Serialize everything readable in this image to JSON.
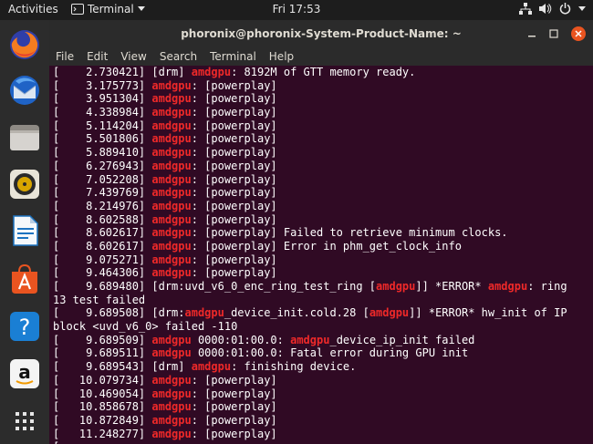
{
  "topbar": {
    "activities": "Activities",
    "app_menu": "Terminal",
    "clock": "Fri 17:53"
  },
  "dock": {
    "items": [
      {
        "name": "firefox-icon"
      },
      {
        "name": "thunderbird-icon"
      },
      {
        "name": "files-icon"
      },
      {
        "name": "rhythmbox-icon"
      },
      {
        "name": "libreoffice-writer-icon"
      },
      {
        "name": "ubuntu-software-icon"
      },
      {
        "name": "help-icon"
      },
      {
        "name": "amazon-icon"
      },
      {
        "name": "show-applications-icon"
      }
    ]
  },
  "window": {
    "title": "phoronix@phoronix-System-Product-Name: ~",
    "menu": [
      "File",
      "Edit",
      "View",
      "Search",
      "Terminal",
      "Help"
    ]
  },
  "colors": {
    "terminal_bg": "#300a24",
    "highlight": "#ef2929",
    "text": "#ffffff"
  },
  "terminal": {
    "lines": [
      [
        {
          "t": "[    2.730421] [drm] "
        },
        {
          "t": "amdgpu",
          "h": true
        },
        {
          "t": ": 8192M of GTT memory ready."
        }
      ],
      [
        {
          "t": "[    3.175773] "
        },
        {
          "t": "amdgpu",
          "h": true
        },
        {
          "t": ": [powerplay]"
        }
      ],
      [
        {
          "t": "[    3.951304] "
        },
        {
          "t": "amdgpu",
          "h": true
        },
        {
          "t": ": [powerplay]"
        }
      ],
      [
        {
          "t": "[    4.338984] "
        },
        {
          "t": "amdgpu",
          "h": true
        },
        {
          "t": ": [powerplay]"
        }
      ],
      [
        {
          "t": "[    5.114204] "
        },
        {
          "t": "amdgpu",
          "h": true
        },
        {
          "t": ": [powerplay]"
        }
      ],
      [
        {
          "t": "[    5.501806] "
        },
        {
          "t": "amdgpu",
          "h": true
        },
        {
          "t": ": [powerplay]"
        }
      ],
      [
        {
          "t": "[    5.889410] "
        },
        {
          "t": "amdgpu",
          "h": true
        },
        {
          "t": ": [powerplay]"
        }
      ],
      [
        {
          "t": "[    6.276943] "
        },
        {
          "t": "amdgpu",
          "h": true
        },
        {
          "t": ": [powerplay]"
        }
      ],
      [
        {
          "t": "[    7.052208] "
        },
        {
          "t": "amdgpu",
          "h": true
        },
        {
          "t": ": [powerplay]"
        }
      ],
      [
        {
          "t": "[    7.439769] "
        },
        {
          "t": "amdgpu",
          "h": true
        },
        {
          "t": ": [powerplay]"
        }
      ],
      [
        {
          "t": "[    8.214976] "
        },
        {
          "t": "amdgpu",
          "h": true
        },
        {
          "t": ": [powerplay]"
        }
      ],
      [
        {
          "t": "[    8.602588] "
        },
        {
          "t": "amdgpu",
          "h": true
        },
        {
          "t": ": [powerplay]"
        }
      ],
      [
        {
          "t": "[    8.602617] "
        },
        {
          "t": "amdgpu",
          "h": true
        },
        {
          "t": ": [powerplay] Failed to retrieve minimum clocks."
        }
      ],
      [
        {
          "t": "[    8.602617] "
        },
        {
          "t": "amdgpu",
          "h": true
        },
        {
          "t": ": [powerplay] Error in phm_get_clock_info"
        }
      ],
      [
        {
          "t": "[    9.075271] "
        },
        {
          "t": "amdgpu",
          "h": true
        },
        {
          "t": ": [powerplay]"
        }
      ],
      [
        {
          "t": "[    9.464306] "
        },
        {
          "t": "amdgpu",
          "h": true
        },
        {
          "t": ": [powerplay]"
        }
      ],
      [
        {
          "t": "[    9.689480] [drm:uvd_v6_0_enc_ring_test_ring ["
        },
        {
          "t": "amdgpu",
          "h": true
        },
        {
          "t": "]] *ERROR* "
        },
        {
          "t": "amdgpu",
          "h": true
        },
        {
          "t": ": ring"
        }
      ],
      [
        {
          "t": "13 test failed"
        }
      ],
      [
        {
          "t": "[    9.689508] [drm:"
        },
        {
          "t": "amdgpu",
          "h": true
        },
        {
          "t": "_device_init.cold.28 ["
        },
        {
          "t": "amdgpu",
          "h": true
        },
        {
          "t": "]] *ERROR* hw_init of IP"
        }
      ],
      [
        {
          "t": "block <uvd_v6_0> failed -110"
        }
      ],
      [
        {
          "t": "[    9.689509] "
        },
        {
          "t": "amdgpu",
          "h": true
        },
        {
          "t": " 0000:01:00.0: "
        },
        {
          "t": "amdgpu",
          "h": true
        },
        {
          "t": "_device_ip_init failed"
        }
      ],
      [
        {
          "t": "[    9.689511] "
        },
        {
          "t": "amdgpu",
          "h": true
        },
        {
          "t": " 0000:01:00.0: Fatal error during GPU init"
        }
      ],
      [
        {
          "t": "[    9.689543] [drm] "
        },
        {
          "t": "amdgpu",
          "h": true
        },
        {
          "t": ": finishing device."
        }
      ],
      [
        {
          "t": "[   10.079734] "
        },
        {
          "t": "amdgpu",
          "h": true
        },
        {
          "t": ": [powerplay]"
        }
      ],
      [
        {
          "t": "[   10.469054] "
        },
        {
          "t": "amdgpu",
          "h": true
        },
        {
          "t": ": [powerplay]"
        }
      ],
      [
        {
          "t": "[   10.858678] "
        },
        {
          "t": "amdgpu",
          "h": true
        },
        {
          "t": ": [powerplay]"
        }
      ],
      [
        {
          "t": "[   10.872849] "
        },
        {
          "t": "amdgpu",
          "h": true
        },
        {
          "t": ": [powerplay]"
        }
      ],
      [
        {
          "t": "[   11.248277] "
        },
        {
          "t": "amdgpu",
          "h": true
        },
        {
          "t": ": [powerplay]"
        }
      ],
      [
        {
          "t": "[   "
        }
      ]
    ]
  }
}
